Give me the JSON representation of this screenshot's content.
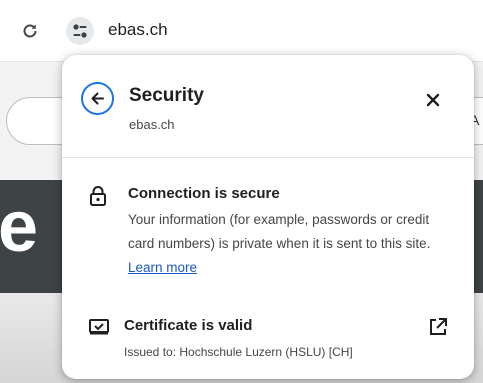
{
  "toolbar": {
    "url": "ebas.ch"
  },
  "background_page": {
    "hero_text": "e",
    "pill_text": "A"
  },
  "popup": {
    "title": "Security",
    "subtitle": "ebas.ch",
    "connection": {
      "title": "Connection is secure",
      "body": "Your information (for example, passwords or credit card numbers) is private when it is sent to this site.",
      "learn_more": "Learn more"
    },
    "certificate": {
      "title": "Certificate is valid",
      "issued_to": "Issued to: Hochschule Luzern (HSLU) [CH]"
    }
  },
  "colors": {
    "accent": "#1a73e8",
    "link": "#1a57c9",
    "hero_bg": "#3e4346"
  },
  "icons": [
    "reload-icon",
    "site-settings-icon",
    "back-arrow-icon",
    "close-icon",
    "lock-icon",
    "certificate-icon",
    "external-link-icon"
  ]
}
